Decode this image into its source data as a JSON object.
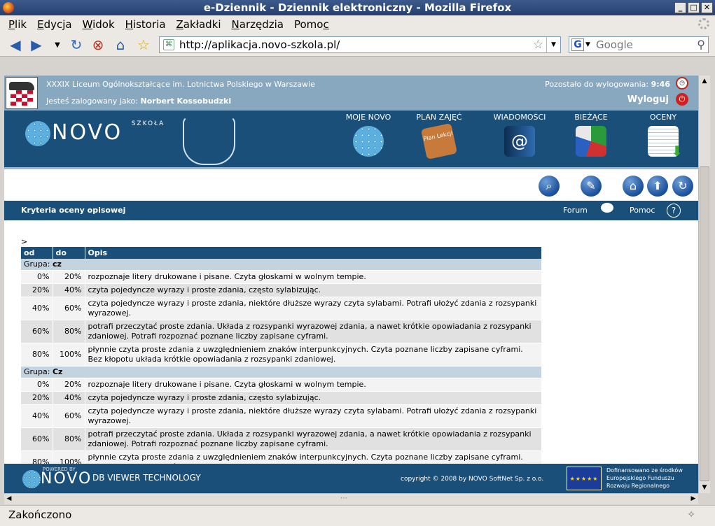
{
  "window": {
    "title": "e-Dziennik - Dziennik elektroniczny - Mozilla Firefox",
    "min": "_",
    "max": "□",
    "close": "✕"
  },
  "menu": [
    {
      "pre": "",
      "u": "P",
      "post": "lik"
    },
    {
      "pre": "",
      "u": "E",
      "post": "dycja"
    },
    {
      "pre": "",
      "u": "W",
      "post": "idok"
    },
    {
      "pre": "",
      "u": "H",
      "post": "istoria"
    },
    {
      "pre": "",
      "u": "Z",
      "post": "akładki"
    },
    {
      "pre": "",
      "u": "N",
      "post": "arzędzia"
    },
    {
      "pre": "Pomo",
      "u": "c",
      "post": ""
    }
  ],
  "address": {
    "url": "http://aplikacja.novo-szkola.pl/"
  },
  "search": {
    "placeholder": "Google"
  },
  "header": {
    "school": "XXXIX Liceum Ogólnokształcące im. Lotnictwa Polskiego w Warszawie",
    "logged_label": "Jesteś zalogowany jako:",
    "user": "Norbert Kossobudzki",
    "remaining_label": "Pozostało do wylogowania:",
    "remaining_time": "9:46",
    "logout": "Wyloguj"
  },
  "brand": {
    "name": "NOVO",
    "sub": "SZKOŁA"
  },
  "modules": [
    {
      "label": "MOJE NOVO",
      "color": "#4a90d0"
    },
    {
      "label": "PLAN ZAJĘĆ",
      "color": "#c77a3a",
      "note": "Plan Lekcji"
    },
    {
      "label": "WIADOMOŚCI",
      "color": "#2f6cb0"
    },
    {
      "label": "BIEŻĄCE",
      "color": "#e8e8e8"
    },
    {
      "label": "OCENY",
      "color": "#d8dde3"
    }
  ],
  "page": {
    "title": "Kryteria oceny opisowej",
    "forum": "Forum",
    "help": "Pomoc",
    "gt": ">"
  },
  "table": {
    "headers": {
      "from": "od",
      "to": "do",
      "desc": "Opis"
    },
    "groups": [
      {
        "label": "Grupa:",
        "name": "cz",
        "rows": [
          {
            "from": "0%",
            "to": "20%",
            "desc": "rozpoznaje litery drukowane i pisane. Czyta głoskami w wolnym tempie."
          },
          {
            "from": "20%",
            "to": "40%",
            "desc": "czyta pojedyncze wyrazy i proste zdania, często sylabizując."
          },
          {
            "from": "40%",
            "to": "60%",
            "desc": "czyta pojedyncze wyrazy i proste zdania, niektóre dłuższe wyrazy czyta sylabami. Potrafi ułożyć zdania z rozsypanki wyrazowej."
          },
          {
            "from": "60%",
            "to": "80%",
            "desc": "potrafi przeczytać proste zdania. Układa z rozsypanki wyrazowej zdania, a nawet krótkie opowiadania z rozsypanki zdaniowej. Potrafi rozpoznać poznane liczby zapisane cyframi."
          },
          {
            "from": "80%",
            "to": "100%",
            "desc": "płynnie czyta proste zdania z uwzględnieniem znaków interpunkcyjnych. Czyta poznane liczby zapisane cyframi. Bez kłopotu układa krótkie opowiadania z rozsypanki zdaniowej."
          }
        ]
      },
      {
        "label": "Grupa:",
        "name": "Cz",
        "rows": [
          {
            "from": "0%",
            "to": "20%",
            "desc": "rozpoznaje litery drukowane i pisane. Czyta głoskami w wolnym tempie."
          },
          {
            "from": "20%",
            "to": "40%",
            "desc": "czyta pojedyncze wyrazy i proste zdania, często sylabizując."
          },
          {
            "from": "40%",
            "to": "60%",
            "desc": "czyta pojedyncze wyrazy i proste zdania, niektóre dłuższe wyrazy czyta sylabami. Potrafi ułożyć zdania z rozsypanki wyrazowej."
          },
          {
            "from": "60%",
            "to": "80%",
            "desc": "potrafi przeczytać proste zdania. Układa z rozsypanki wyrazowej zdania, a nawet krótkie opowiadania z rozsypanki zdaniowej. Potrafi rozpoznać poznane liczby zapisane cyframi."
          },
          {
            "from": "80%",
            "to": "100%",
            "desc": "płynnie czyta proste zdania z uwzględnieniem znaków interpunkcyjnych. Czyta poznane liczby zapisane cyframi. Bez kłopotu układa krótkie opowiadania z rozsypanki zdaniowej."
          }
        ]
      }
    ]
  },
  "footer": {
    "powered": "POWERED BY",
    "novo": "NOVO",
    "tech": "DB VIEWER TECHNOLOGY",
    "copyright": "copyright © 2008 by NOVO SoftNet Sp. z o.o.",
    "eu1": "Dofinansowano ze środków",
    "eu2": "Europejskiego Funduszu",
    "eu3": "Rozwoju Regionalnego"
  },
  "status": {
    "text": "Zakończono"
  },
  "icons": {
    "back": "back-arrow-icon",
    "forward": "forward-arrow-icon",
    "reload": "reload-icon",
    "stop": "stop-icon",
    "home": "home-icon"
  }
}
